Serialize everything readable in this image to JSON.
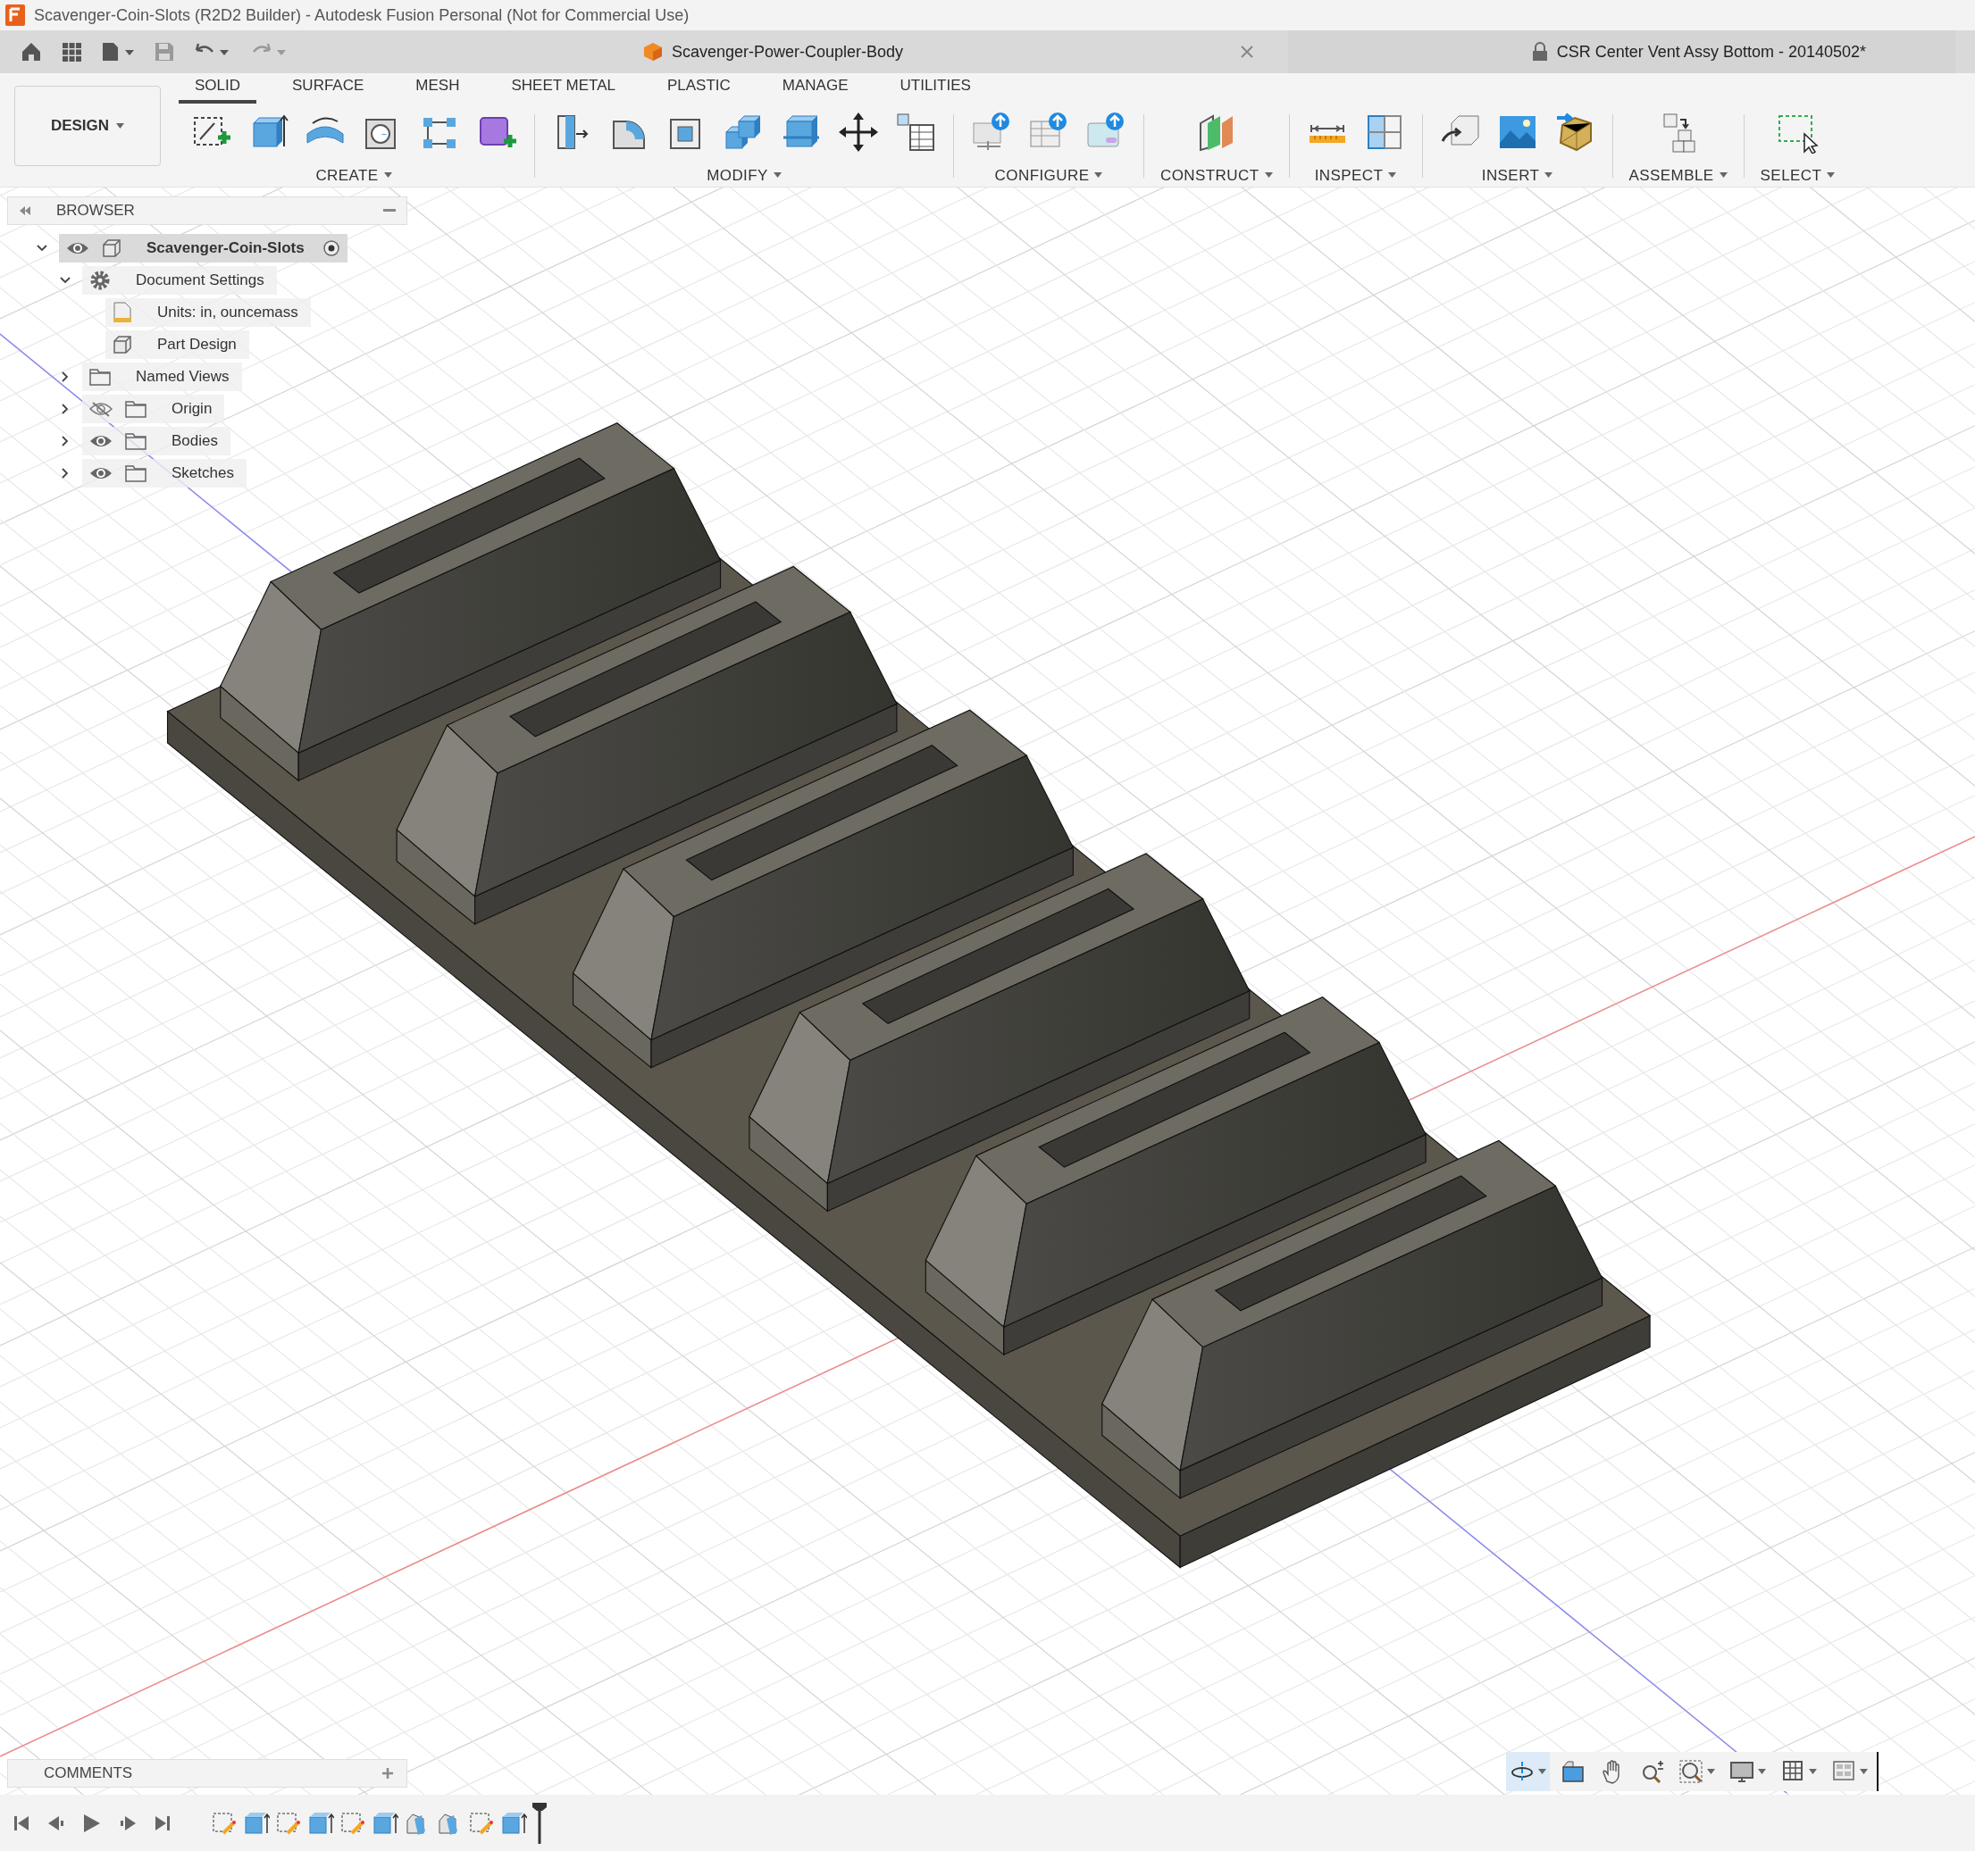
{
  "window": {
    "title": "Scavenger-Coin-Slots (R2D2 Builder) - Autodesk Fusion Personal (Not for Commercial Use)"
  },
  "doc_tabs": [
    {
      "label": "Scavenger-Power-Coupler-Body",
      "selected": true,
      "locked": false
    },
    {
      "label": "CSR Center Vent Assy Bottom - 20140502*",
      "selected": false,
      "locked": true
    }
  ],
  "workspace": "DESIGN",
  "toolbar_tabs": [
    {
      "label": "SOLID",
      "selected": true
    },
    {
      "label": "SURFACE",
      "selected": false
    },
    {
      "label": "MESH",
      "selected": false
    },
    {
      "label": "SHEET METAL",
      "selected": false
    },
    {
      "label": "PLASTIC",
      "selected": false
    },
    {
      "label": "MANAGE",
      "selected": false
    },
    {
      "label": "UTILITIES",
      "selected": false
    }
  ],
  "tool_groups": [
    {
      "label": "CREATE"
    },
    {
      "label": "MODIFY"
    },
    {
      "label": "CONFIGURE"
    },
    {
      "label": "CONSTRUCT"
    },
    {
      "label": "INSPECT"
    },
    {
      "label": "INSERT"
    },
    {
      "label": "ASSEMBLE"
    },
    {
      "label": "SELECT"
    }
  ],
  "browser": {
    "title": "BROWSER",
    "tree": [
      {
        "label": "Scavenger-Coin-Slots",
        "kind": "component",
        "expanded": true,
        "visible": true,
        "active": true,
        "children": [
          {
            "label": "Document Settings",
            "kind": "settings",
            "expanded": true,
            "children": [
              {
                "label": "Units: in, ouncemass",
                "kind": "units"
              },
              {
                "label": "Part Design",
                "kind": "design"
              }
            ]
          },
          {
            "label": "Named Views",
            "kind": "folder",
            "expanded": false
          },
          {
            "label": "Origin",
            "kind": "folder",
            "expanded": false,
            "visible": false
          },
          {
            "label": "Bodies",
            "kind": "folder",
            "expanded": false,
            "visible": true
          },
          {
            "label": "Sketches",
            "kind": "folder",
            "expanded": false,
            "visible": true
          }
        ]
      }
    ]
  },
  "comments": {
    "title": "COMMENTS"
  }
}
